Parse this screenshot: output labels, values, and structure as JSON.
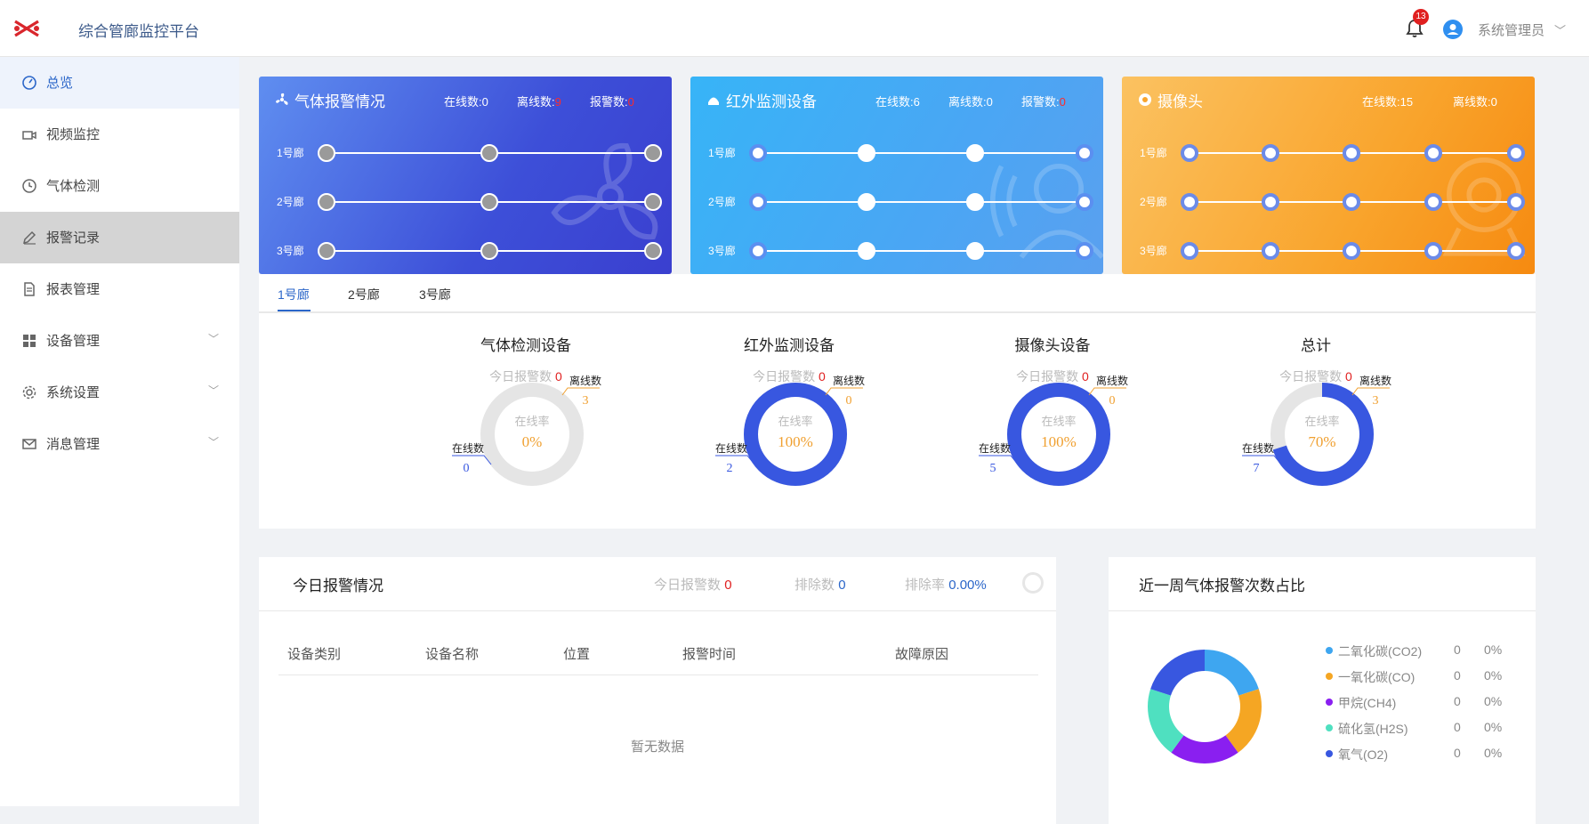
{
  "header": {
    "app_title": "综合管廊监控平台",
    "notification_count": "13",
    "user_name": "系统管理员"
  },
  "sidebar": {
    "items": [
      {
        "label": "总览",
        "icon": "dashboard-icon"
      },
      {
        "label": "视频监控",
        "icon": "video-camera-icon"
      },
      {
        "label": "气体检测",
        "icon": "clock-icon"
      },
      {
        "label": "报警记录",
        "icon": "pen-icon"
      },
      {
        "label": "报表管理",
        "icon": "document-icon"
      },
      {
        "label": "设备管理",
        "icon": "grid-icon"
      },
      {
        "label": "系统设置",
        "icon": "gear-icon"
      },
      {
        "label": "消息管理",
        "icon": "mail-icon"
      }
    ]
  },
  "cards": {
    "gas": {
      "title": "气体报警情况",
      "online_label": "在线数:",
      "online": "0",
      "offline_label": "离线数:",
      "offline": "9",
      "alarm_label": "报警数:",
      "alarm": "0",
      "rows": [
        "1号廊",
        "2号廊",
        "3号廊"
      ]
    },
    "ir": {
      "title": "红外监测设备",
      "online_label": "在线数:",
      "online": "6",
      "offline_label": "离线数:",
      "offline": "0",
      "alarm_label": "报警数:",
      "alarm": "0",
      "rows": [
        "1号廊",
        "2号廊",
        "3号廊"
      ]
    },
    "cam": {
      "title": "摄像头",
      "online_label": "在线数:",
      "online": "15",
      "offline_label": "离线数:",
      "offline": "0",
      "rows": [
        "1号廊",
        "2号廊",
        "3号廊"
      ]
    }
  },
  "tabs": [
    "1号廊",
    "2号廊",
    "3号廊"
  ],
  "stats": [
    {
      "title": "气体检测设备",
      "today_label": "今日报警数",
      "today": "0",
      "online_label": "在线数",
      "online": "0",
      "offline_label": "离线数",
      "offline": "3",
      "rate_label": "在线率",
      "rate": "0%",
      "rate_value": 0
    },
    {
      "title": "红外监测设备",
      "today_label": "今日报警数",
      "today": "0",
      "online_label": "在线数",
      "online": "2",
      "offline_label": "离线数",
      "offline": "0",
      "rate_label": "在线率",
      "rate": "100%",
      "rate_value": 1
    },
    {
      "title": "摄像头设备",
      "today_label": "今日报警数",
      "today": "0",
      "online_label": "在线数",
      "online": "5",
      "offline_label": "离线数",
      "offline": "0",
      "rate_label": "在线率",
      "rate": "100%",
      "rate_value": 1
    },
    {
      "title": "总计",
      "today_label": "今日报警数",
      "today": "0",
      "online_label": "在线数",
      "online": "7",
      "offline_label": "离线数",
      "offline": "3",
      "rate_label": "在线率",
      "rate": "70%",
      "rate_value": 0.7
    }
  ],
  "alarm_today": {
    "title": "今日报警情况",
    "today_label": "今日报警数",
    "today": "0",
    "cleared_label": "排除数",
    "cleared": "0",
    "rate_label": "排除率",
    "rate": "0.00%",
    "columns": [
      "设备类别",
      "设备名称",
      "位置",
      "报警时间",
      "故障原因"
    ],
    "empty_text": "暂无数据"
  },
  "gas_week": {
    "title": "近一周气体报警次数占比",
    "legend": [
      {
        "name": "二氧化碳(CO2)",
        "count": "0",
        "pct": "0%",
        "color": "#3ea6f0"
      },
      {
        "name": "一氧化碳(CO)",
        "count": "0",
        "pct": "0%",
        "color": "#f5a623"
      },
      {
        "name": "甲烷(CH4)",
        "count": "0",
        "pct": "0%",
        "color": "#8a1ff0"
      },
      {
        "name": "硫化氢(H2S)",
        "count": "0",
        "pct": "0%",
        "color": "#4fe0c0"
      },
      {
        "name": "氧气(O2)",
        "count": "0",
        "pct": "0%",
        "color": "#3857e0"
      }
    ]
  },
  "colors": {
    "accent": "#2b66c9",
    "online": "#3857e0",
    "offline": "#e5e5e5",
    "rate_text": "#f0a030"
  }
}
